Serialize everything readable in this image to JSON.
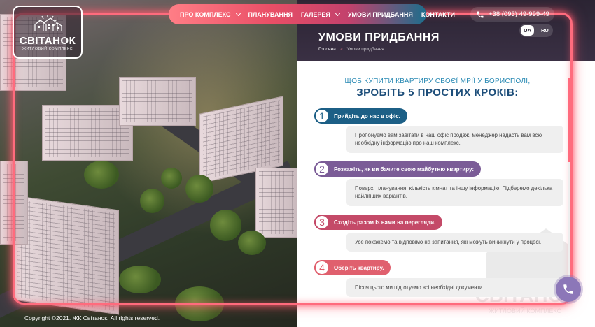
{
  "brand": {
    "name": "СВІТАНОК",
    "tagline": "ЖИТЛОВИЙ КОМПЛЕКС"
  },
  "nav": {
    "items": [
      {
        "label": "ПРО КОМПЛЕКС",
        "has_dropdown": true
      },
      {
        "label": "ПЛАНУВАННЯ",
        "has_dropdown": false
      },
      {
        "label": "ГАЛЕРЕЯ",
        "has_dropdown": true
      },
      {
        "label": "УМОВИ ПРИДБАННЯ",
        "has_dropdown": false
      },
      {
        "label": "КОНТАКТИ",
        "has_dropdown": false
      }
    ]
  },
  "phone": {
    "number": "+38 (093) 49-999-49",
    "icon": "phone-icon"
  },
  "languages": {
    "active": "UA",
    "other": "RU"
  },
  "page": {
    "title": "УМОВИ ПРИДБАННЯ",
    "breadcrumb": {
      "home": "Головна",
      "separator": ">",
      "current": "Умови придбання"
    }
  },
  "intro": {
    "line1": "ЩОБ КУПИТИ КВАРТИРУ СВОЄЇ МРІЇ У БОРИСПОЛІ,",
    "line2": "ЗРОБІТЬ 5 ПРОСТИХ КРОКІВ:"
  },
  "steps": [
    {
      "num": "1",
      "title": "Прийдіть до нас в офіс.",
      "text": "Пропонуємо вам завітати в наш офіс продаж, менеджер надасть вам всю необхідну інформацію про наш комплекс.",
      "color": "#1c5f86"
    },
    {
      "num": "2",
      "title": "Розкажіть, як ви бачите свою майбутню квартиру:",
      "text": "Поверх, планування, кількість кімнат та іншу інформацію. Підберемо декілька найліпших варіантів.",
      "color": "#7b5c97"
    },
    {
      "num": "3",
      "title": "Сходіть разом із нами на перегляди.",
      "text": "Усе покажемо та відповімо на запитання, які можуть виникнути у процесі.",
      "color": "#c44a68"
    },
    {
      "num": "4",
      "title": "Оберіть квартиру.",
      "text": "Після цього ми підготуємо всі необхідні документи.",
      "color": "#e0606e"
    }
  ],
  "watermark": {
    "name": "СВІТАНОК",
    "sub": "ЖИТЛОВИЙ КОМПЛЕКС"
  },
  "footer": {
    "copyright": "Copyright ©2021. ЖК Світанок. All rights reserved."
  },
  "colors": {
    "neon": "#ff6b7d",
    "call_button": "#8c77b8",
    "heading_blue": "#1d4e7a"
  }
}
